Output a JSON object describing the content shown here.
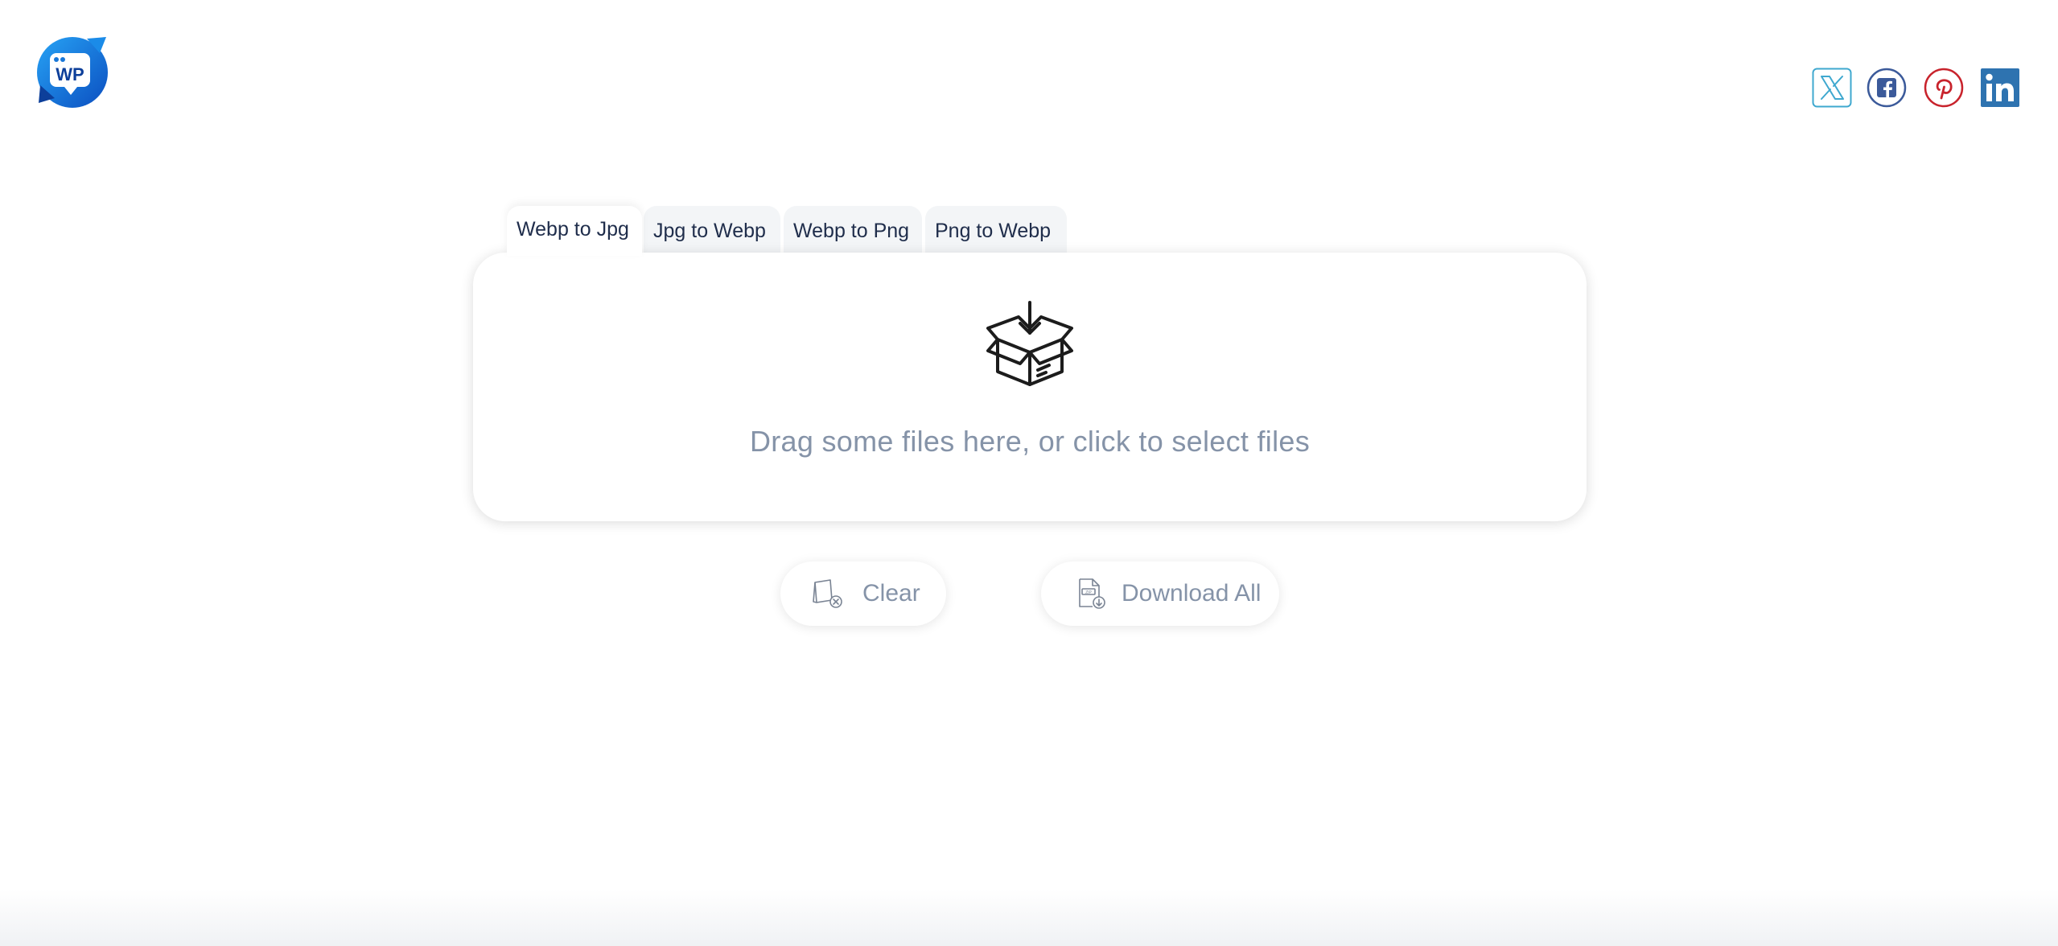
{
  "logo": {
    "text": "WP",
    "icon": "wp-logo-icon"
  },
  "social": [
    {
      "name": "x-twitter",
      "icon": "x-icon",
      "color": "#3fa8cf"
    },
    {
      "name": "facebook",
      "icon": "facebook-icon",
      "color": "#3b5a9a"
    },
    {
      "name": "pinterest",
      "icon": "pinterest-icon",
      "color": "#c8232c"
    },
    {
      "name": "linkedin",
      "icon": "linkedin-icon",
      "color": "#2e73b0"
    }
  ],
  "tabs": [
    {
      "label": "Webp to Jpg",
      "active": true
    },
    {
      "label": "Jpg to Webp",
      "active": false
    },
    {
      "label": "Webp to Png",
      "active": false
    },
    {
      "label": "Png to Webp",
      "active": false
    }
  ],
  "dropzone": {
    "icon": "box-download-icon",
    "text": "Drag some files here, or click to select files"
  },
  "actions": {
    "clear_label": "Clear",
    "clear_icon": "clear-files-icon",
    "download_label": "Download All",
    "download_icon": "zip-download-icon"
  },
  "colors": {
    "text_dark": "#1f2d4b",
    "text_muted": "#8593a8",
    "brand_blue": "#1877d8"
  }
}
